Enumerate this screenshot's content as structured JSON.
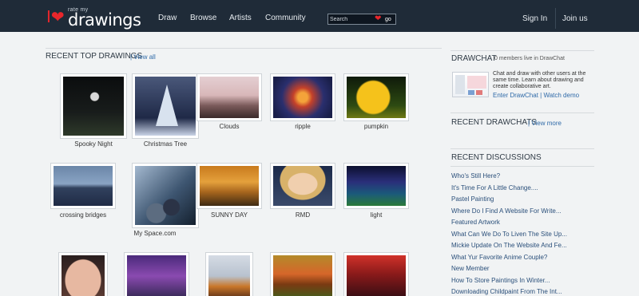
{
  "brand": {
    "small": "rate my",
    "word": "drawings"
  },
  "nav": [
    {
      "label": "Draw"
    },
    {
      "label": "Browse"
    },
    {
      "label": "Artists"
    },
    {
      "label": "Community"
    }
  ],
  "search": {
    "placeholder": "Search",
    "go": "go"
  },
  "auth": {
    "signin": "Sign In",
    "join": "Join us"
  },
  "top_drawings": {
    "title": "RECENT TOP DRAWINGS",
    "view_all": "| View all",
    "items": [
      {
        "caption": "Spooky Night"
      },
      {
        "caption": "Christmas Tree"
      },
      {
        "caption": "Clouds"
      },
      {
        "caption": "ripple"
      },
      {
        "caption": "pumpkin"
      },
      {
        "caption": "crossing bridges"
      },
      {
        "caption": "My Space.com"
      },
      {
        "caption": "SUNNY DAY"
      },
      {
        "caption": "RMD"
      },
      {
        "caption": "light"
      },
      {
        "caption": ""
      },
      {
        "caption": ""
      },
      {
        "caption": ""
      },
      {
        "caption": ""
      },
      {
        "caption": ""
      }
    ]
  },
  "drawchat": {
    "title": "DRAWCHAT",
    "count": "0 members live in DrawChat",
    "description": "Chat and draw with other users at the same time. Learn about drawing and create collaborative art.",
    "enter": "Enter DrawChat",
    "sep": " | ",
    "watch": "Watch demo"
  },
  "recent_drawchats": {
    "title": "RECENT DRAWCHATS",
    "link": "| View more"
  },
  "recent_discussions": {
    "title": "RECENT DISCUSSIONS",
    "items": [
      "Who's Still Here?",
      "It's Time For A Little Change....",
      "Pastel Painting",
      "Where Do I Find A Website For Write...",
      "Featured Artwork",
      "What Can We Do To Liven The Site Up...",
      "Mickie Update On The Website And Fe...",
      "What Yur Favorite Anime Couple?",
      "New Member",
      "How To Store Paintings In Winter...",
      "Downloading Childpaint From The Int..."
    ]
  },
  "colors": {
    "topbar": "#1f2b38",
    "link": "#2f6aa8",
    "heart": "#e8262b",
    "background": "#f1f3f4"
  }
}
